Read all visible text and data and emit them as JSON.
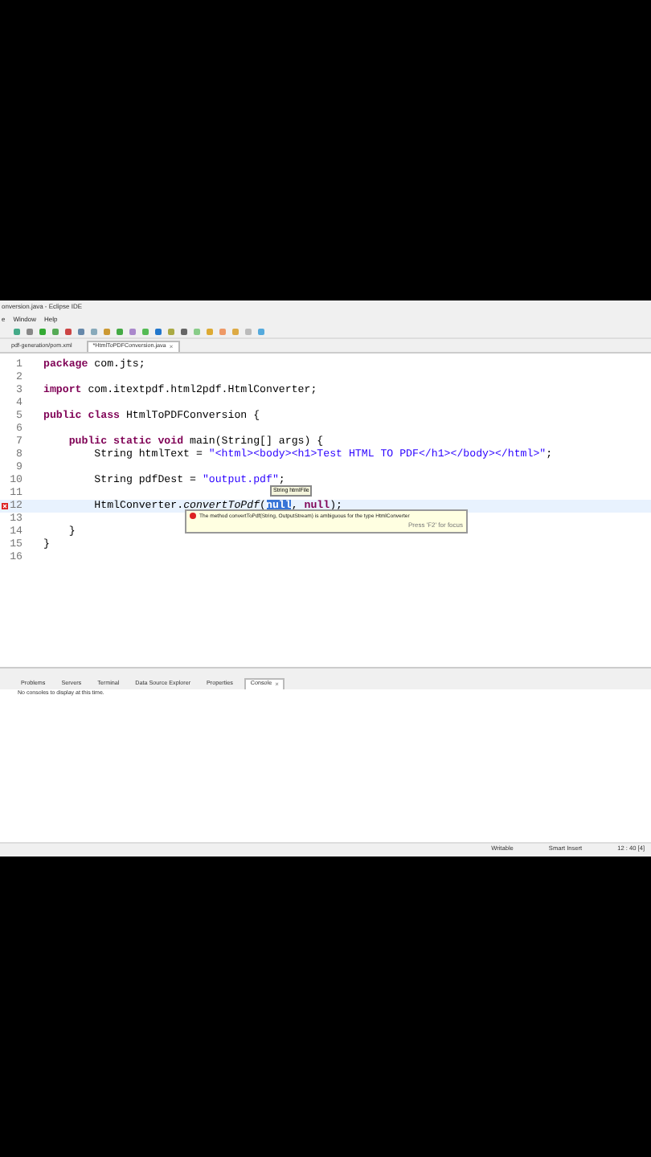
{
  "window": {
    "title": "onversion.java - Eclipse IDE"
  },
  "menu": [
    "e",
    "Window",
    "Help"
  ],
  "editor_tabs": [
    {
      "label": "pdf-generation/pom.xml",
      "selected": false
    },
    {
      "label": "*HtmlToPDFConversion.java",
      "selected": true,
      "close": "×"
    }
  ],
  "code_lines": [
    {
      "number": "1",
      "tokens": [
        {
          "text": "package",
          "kind": "keyword"
        },
        {
          "text": " com.jts;",
          "kind": "plain"
        }
      ]
    },
    {
      "number": "2"
    },
    {
      "number": "3",
      "tokens": [
        {
          "text": "import",
          "kind": "keyword"
        },
        {
          "text": " com.itextpdf.html2pdf.HtmlConverter;",
          "kind": "plain"
        }
      ]
    },
    {
      "number": "4"
    },
    {
      "number": "5",
      "tokens": [
        {
          "text": "public class",
          "kind": "keyword"
        },
        {
          "text": " HtmlToPDFConversion {",
          "kind": "plain"
        }
      ]
    },
    {
      "number": "6"
    },
    {
      "number": "7",
      "tokens": [
        {
          "text": "    public static void",
          "kind": "keyword"
        },
        {
          "text": " main(String[] args) {",
          "kind": "plain"
        }
      ]
    },
    {
      "number": "8",
      "tokens": [
        {
          "text": "        String htmlText = ",
          "kind": "plain"
        },
        {
          "text": "\"<html><body><h1>Test HTML TO PDF</h1></body></html>\"",
          "kind": "string"
        },
        {
          "text": ";",
          "kind": "plain"
        }
      ]
    },
    {
      "number": "9"
    },
    {
      "number": "10",
      "tokens": [
        {
          "text": "        String pdfDest = ",
          "kind": "plain"
        },
        {
          "text": "\"output.pdf\"",
          "kind": "string"
        },
        {
          "text": ";",
          "kind": "plain"
        }
      ]
    },
    {
      "number": "11"
    },
    {
      "number": "12",
      "error": true,
      "current": true,
      "tokens": [
        {
          "text": "        HtmlConverter.",
          "kind": "plain"
        },
        {
          "text": "convertToPdf",
          "kind": "method"
        },
        {
          "text": "(",
          "kind": "plain"
        },
        {
          "text": "null",
          "kind": "selected"
        },
        {
          "text": ", ",
          "kind": "plain"
        },
        {
          "text": "null",
          "kind": "keyword"
        },
        {
          "text": ");",
          "kind": "plain"
        }
      ]
    },
    {
      "number": "13"
    },
    {
      "number": "14",
      "tokens": [
        {
          "text": "    }",
          "kind": "plain"
        }
      ]
    },
    {
      "number": "15",
      "tokens": [
        {
          "text": "}",
          "kind": "plain"
        }
      ]
    },
    {
      "number": "16"
    }
  ],
  "parameter_hint": "String htmlFile",
  "error_tooltip": {
    "message": "The method convertToPdf(String, OutputStream) is ambiguous for the type HtmlConverter",
    "footer": "Press 'F2' for focus"
  },
  "bottom_tabs": [
    {
      "label": "Problems",
      "selected": false
    },
    {
      "label": "Servers",
      "selected": false
    },
    {
      "label": "Terminal",
      "selected": false
    },
    {
      "label": "Data Source Explorer",
      "selected": false
    },
    {
      "label": "Properties",
      "selected": false
    },
    {
      "label": "Console",
      "selected": true,
      "close": "×"
    }
  ],
  "console_message": "No consoles to display at this time.",
  "status_bar": [
    "Writable",
    "Smart Insert",
    "12 : 40 [4]"
  ]
}
